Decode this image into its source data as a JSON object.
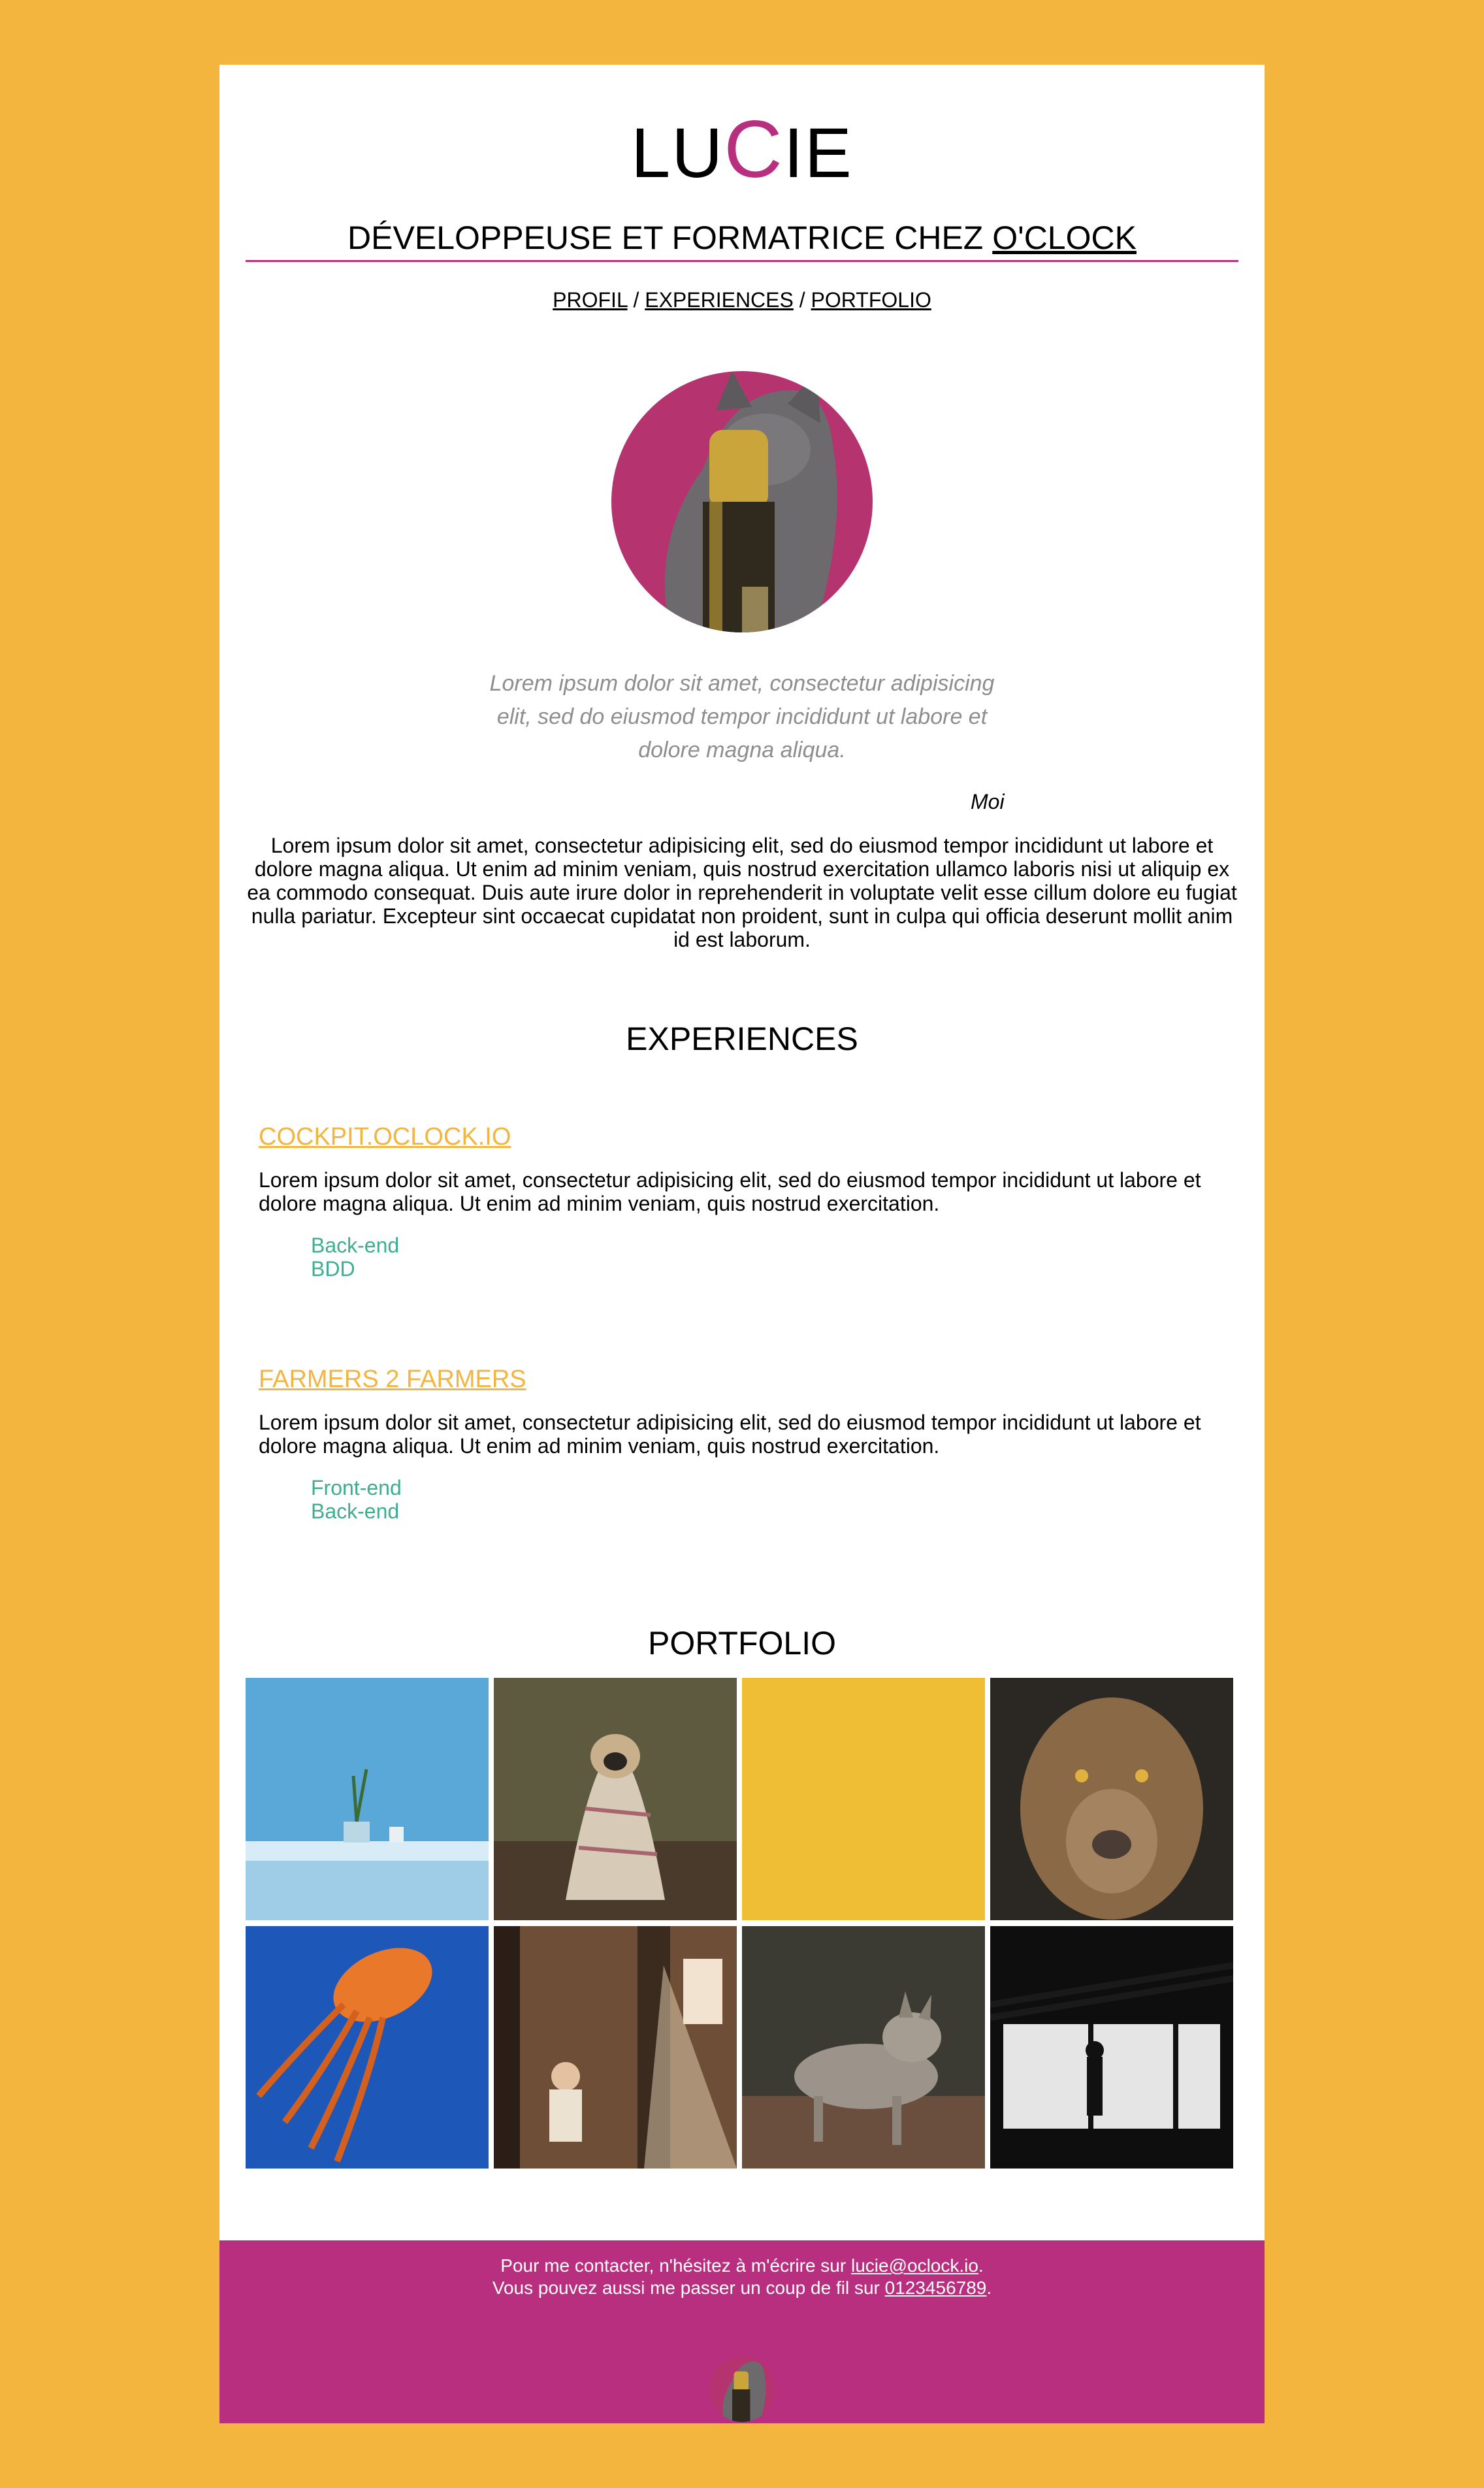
{
  "header": {
    "logo_prefix": "LU",
    "logo_accent": "C",
    "logo_suffix": "IE",
    "tagline_prefix": "DÉVELOPPEUSE ET FORMATRICE CHEZ",
    "tagline_link": "O'CLOCK"
  },
  "nav": {
    "items": [
      "PROFIL",
      "EXPERIENCES",
      "PORTFOLIO"
    ],
    "separator": "/"
  },
  "profile": {
    "quote": "Lorem ipsum dolor sit amet, consectetur adipisicing elit, sed do eiusmod tempor incididunt ut labore et dolore magna aliqua.",
    "quote_author": "Moi",
    "text": "Lorem ipsum dolor sit amet, consectetur adipisicing elit, sed do eiusmod tempor incididunt ut labore et dolore magna aliqua. Ut enim ad minim veniam, quis nostrud exercitation ullamco laboris nisi ut aliquip ex ea commodo consequat. Duis aute irure dolor in reprehenderit in voluptate velit esse cillum dolore eu fugiat nulla pariatur. Excepteur sint occaecat cupidatat non proident, sunt in culpa qui officia deserunt mollit anim id est laborum."
  },
  "experiences": {
    "title": "EXPERIENCES",
    "items": [
      {
        "name": "COCKPIT.OCLOCK.IO",
        "description": "Lorem ipsum dolor sit amet, consectetur adipisicing elit, sed do eiusmod tempor incididunt ut labore et dolore magna aliqua. Ut enim ad minim veniam, quis nostrud exercitation.",
        "tags": [
          "Back-end",
          "BDD"
        ]
      },
      {
        "name": "FARMERS 2 FARMERS",
        "description": "Lorem ipsum dolor sit amet, consectetur adipisicing elit, sed do eiusmod tempor incididunt ut labore et dolore magna aliqua. Ut enim ad minim veniam, quis nostrud exercitation.",
        "tags": [
          "Front-end",
          "Back-end"
        ]
      }
    ]
  },
  "portfolio": {
    "title": "PORTFOLIO",
    "images": [
      "vase-on-table",
      "pug-in-blanket",
      "yellow-texture",
      "lioness",
      "jellyfish",
      "man-in-sunlit-room",
      "coyote",
      "silhouette-in-hangar"
    ]
  },
  "footer": {
    "line1_prefix": "Pour me contacter, n'hésitez à m'écrire sur",
    "email": "lucie@oclock.io",
    "line1_suffix": ".",
    "line2_prefix": "Vous pouvez aussi me passer un coup de fil sur",
    "phone": "0123456789",
    "line2_suffix": "."
  },
  "colors": {
    "background": "#F4B53F",
    "accent": "#B82F80",
    "tag": "#3DAE8E",
    "quote": "#8e8e8e"
  }
}
